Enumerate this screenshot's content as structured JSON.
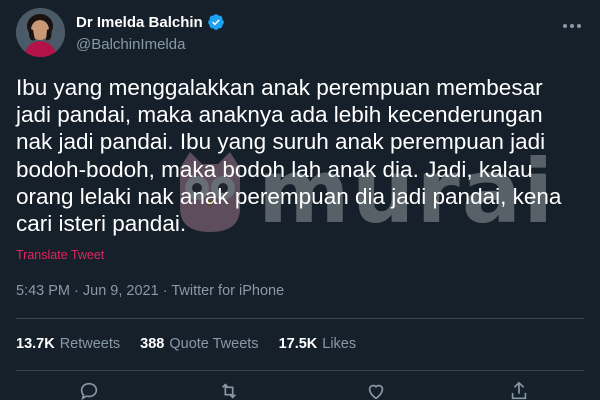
{
  "author": {
    "name": "Dr Imelda Balchin",
    "handle": "@BalchinImelda",
    "verified_icon": "verified-badge-icon"
  },
  "tweet": {
    "text": "Ibu yang menggalakkan anak perempuan membesar\njadi pandai, maka anaknya ada lebih kecenderungan\nnak jadi pandai. Ibu yang suruh anak perempuan jadi\nbodoh-bodoh, maka bodoh lah anak dia. Jadi, kalau\norang lelaki nak anak perempuan dia jadi pandai, kena\ncari isteri pandai.",
    "translate_label": "Translate Tweet"
  },
  "meta": {
    "time": "5:43 PM",
    "date": "Jun 9, 2021",
    "source": "Twitter for iPhone",
    "separator": " · "
  },
  "stats": {
    "retweets": {
      "count": "13.7K",
      "label": "Retweets"
    },
    "quotes": {
      "count": "388",
      "label": "Quote Tweets"
    },
    "likes": {
      "count": "17.5K",
      "label": "Likes"
    }
  },
  "watermark": {
    "text": "murai"
  },
  "colors": {
    "background": "#15202b",
    "text": "#ffffff",
    "muted": "#8899a6",
    "divider": "#38444d",
    "translate": "#e0245e",
    "verified": "#1da1f2"
  },
  "icons": [
    "more-options-icon",
    "reply-icon",
    "retweet-icon",
    "like-icon",
    "share-icon",
    "owl-logo-icon"
  ]
}
